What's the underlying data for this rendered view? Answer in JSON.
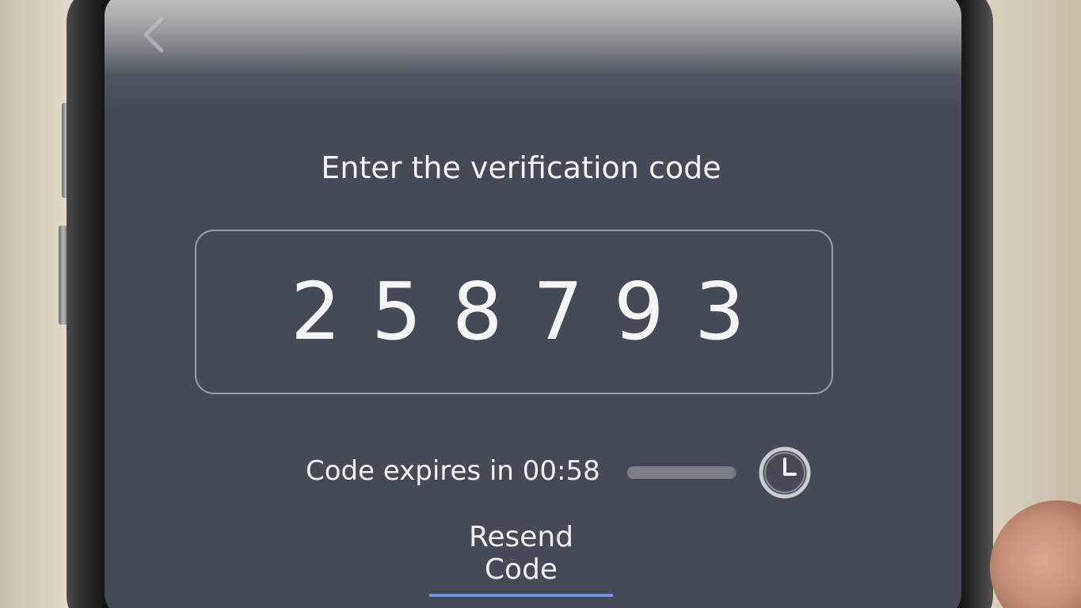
{
  "screen": {
    "back_icon": "chevron-left-icon",
    "title": "Enter the verification code",
    "code_digits": [
      "2",
      "5",
      "8",
      "7",
      "9",
      "3"
    ],
    "expiry_text": "Code expires in 00:58",
    "expiry_progress": 0.97,
    "timer_icon": "clock-icon",
    "resend_label": "Resend Code"
  },
  "colors": {
    "screen_background": "#444b57",
    "text": "#f2f3f5",
    "resend_underline": "#6f8fe0",
    "back_icon": "#a9c6ee"
  }
}
